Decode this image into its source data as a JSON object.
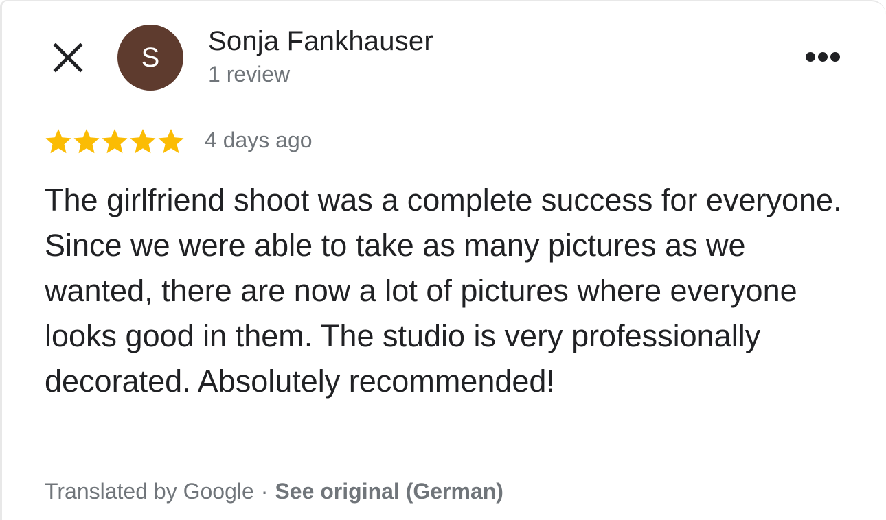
{
  "colors": {
    "avatar_bg": "#5e3b2e",
    "star": "#fbbc04",
    "text_primary": "#202124",
    "text_secondary": "#70757a"
  },
  "header": {
    "close_icon": "close-icon",
    "avatar_initial": "S",
    "reviewer_name": "Sonja Fankhauser",
    "review_count": "1 review",
    "more_icon": "more-horizontal-icon"
  },
  "review": {
    "rating": 5,
    "max_rating": 5,
    "date": "4 days ago",
    "text": "The girlfriend shoot was a complete success for everyone. Since we were able to take as many pictures as we wanted, there are now a lot of pictures where everyone looks good in them. The studio is very professionally decorated. Absolutely recommended!"
  },
  "translation": {
    "label": "Translated by Google",
    "separator": "·",
    "see_original": "See original (German)"
  }
}
